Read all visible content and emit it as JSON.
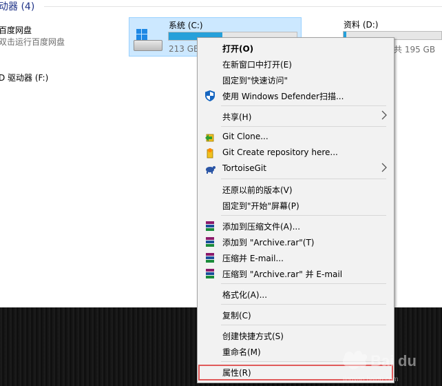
{
  "explorer": {
    "section_title": "动器 (4)",
    "baidu": {
      "name": "百度网盘",
      "subtitle": "双击运行百度网盘"
    },
    "dvd": {
      "label": "D 驱动器 (F:)"
    },
    "drive_c": {
      "label": "系统 (C:)",
      "capacity": "213 GB",
      "used_fraction": 0.42
    },
    "drive_d": {
      "label": "资料 (D:)",
      "capacity": "共 195 GB"
    }
  },
  "menu": {
    "items": [
      {
        "label": "打开(O)",
        "icon": ""
      },
      {
        "label": "在新窗口中打开(E)",
        "icon": ""
      },
      {
        "label": "固定到\"快速访问\"",
        "icon": ""
      },
      {
        "label": "使用 Windows Defender扫描...",
        "icon": "defender-shield-icon"
      },
      {
        "label": "共享(H)",
        "icon": ""
      },
      {
        "label": "Git Clone...",
        "icon": "git-clone-icon"
      },
      {
        "label": "Git Create repository here...",
        "icon": "git-create-repo-icon"
      },
      {
        "label": "TortoiseGit",
        "icon": "tortoisegit-icon"
      },
      {
        "label": "还原以前的版本(V)",
        "icon": ""
      },
      {
        "label": "固定到\"开始\"屏幕(P)",
        "icon": ""
      },
      {
        "label": "添加到压缩文件(A)...",
        "icon": "winrar-icon"
      },
      {
        "label": "添加到 \"Archive.rar\"(T)",
        "icon": "winrar-icon"
      },
      {
        "label": "压缩并 E-mail...",
        "icon": "winrar-icon"
      },
      {
        "label": "压缩到 \"Archive.rar\" 并 E-mail",
        "icon": "winrar-icon"
      },
      {
        "label": "格式化(A)...",
        "icon": ""
      },
      {
        "label": "复制(C)",
        "icon": ""
      },
      {
        "label": "创建快捷方式(S)",
        "icon": ""
      },
      {
        "label": "重命名(M)",
        "icon": ""
      },
      {
        "label": "属性(R)",
        "icon": ""
      }
    ]
  },
  "colors": {
    "selection": "#cce8ff",
    "accent": "#26a0da",
    "highlight_box": "#e05a5a"
  }
}
